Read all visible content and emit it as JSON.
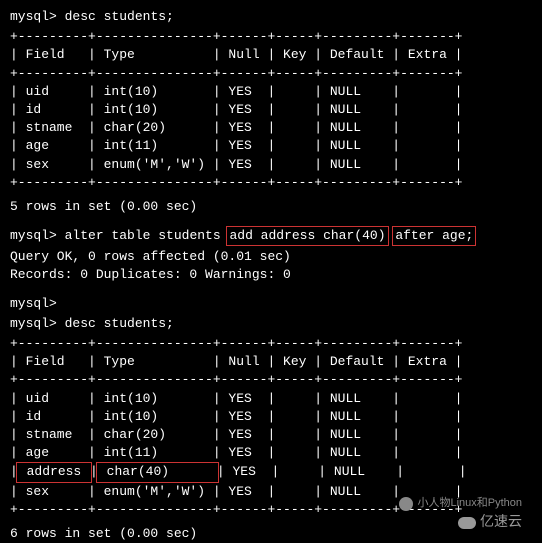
{
  "session": {
    "prompt": "mysql>",
    "cmd1": "desc students;",
    "cmd2_pre": "alter table students",
    "cmd2_box1": "add address char(40)",
    "cmd2_box2": "after age;",
    "cmd3": "desc students;",
    "query_ok": "Query OK, 0 rows affected (0.01 sec)",
    "records": "Records: 0  Duplicates: 0  Warnings: 0",
    "rows1": "5 rows in set (0.00 sec)",
    "rows2": "6 rows in set (0.00 sec)"
  },
  "table1": {
    "border": "+---------+---------------+------+-----+---------+-------+",
    "header": "| Field   | Type          | Null | Key | Default | Extra |",
    "rows": [
      "| uid     | int(10)       | YES  |     | NULL    |       |",
      "| id      | int(10)       | YES  |     | NULL    |       |",
      "| stname  | char(20)      | YES  |     | NULL    |       |",
      "| age     | int(11)       | YES  |     | NULL    |       |",
      "| sex     | enum('M','W') | YES  |     | NULL    |       |"
    ]
  },
  "table2": {
    "border": "+---------+---------------+------+-----+---------+-------+",
    "header": "| Field   | Type          | Null | Key | Default | Extra |",
    "rows_pre": [
      "| uid     | int(10)       | YES  |     | NULL    |       |",
      "| id      | int(10)       | YES  |     | NULL    |       |",
      "| stname  | char(20)      | YES  |     | NULL    |       |",
      "| age     | int(11)       | YES  |     | NULL    |       |"
    ],
    "row_highlight_field": " address ",
    "row_highlight_type": " char(40)      ",
    "row_highlight_rest": "| YES  |     | NULL    |       |",
    "rows_post": [
      "| sex     | enum('M','W') | YES  |     | NULL    |       |"
    ]
  },
  "watermark": {
    "wechat": "小人物Linux和Python",
    "brand": "亿速云"
  }
}
